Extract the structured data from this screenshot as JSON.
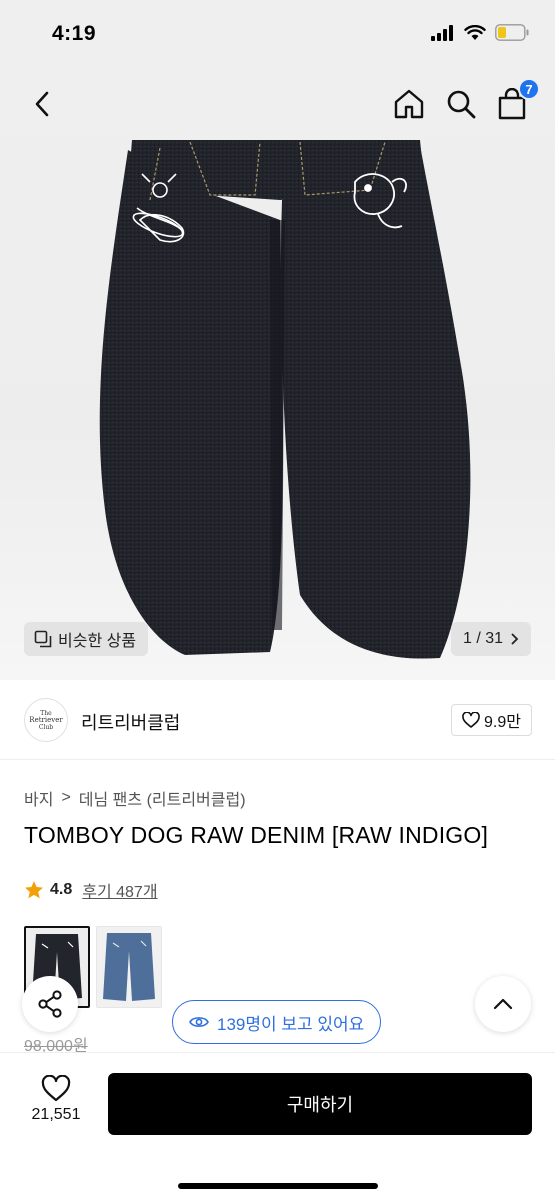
{
  "status_bar": {
    "time": "4:19"
  },
  "header": {
    "cart_count": "7",
    "icons": [
      "back-icon",
      "home-icon",
      "search-icon",
      "cart-icon"
    ]
  },
  "gallery": {
    "similar_label": "비슷한 상품",
    "counter": "1 / 31"
  },
  "brand": {
    "logo_line1": "The",
    "logo_line2": "Retriever",
    "logo_line3": "Club",
    "name": "리트리버클럽",
    "likes": "9.9만"
  },
  "breadcrumb": {
    "category": "바지",
    "separator": ">",
    "subcategory": "데님 팬츠 (리트리버클럽)"
  },
  "product": {
    "title": "TOMBOY DOG RAW DENIM [RAW INDIGO]",
    "rating": "4.8",
    "reviews": "후기 487개",
    "original_price": "98,000원",
    "swatches": [
      "raw-indigo",
      "light-blue"
    ]
  },
  "floating": {
    "viewers": "139명이 보고 있어요"
  },
  "bottom_bar": {
    "like_count": "21,551",
    "buy_label": "구매하기"
  },
  "colors": {
    "accent": "#2f6fe0",
    "badge": "#1e74f0",
    "star": "#f2a007",
    "buy_bg": "#000000"
  }
}
